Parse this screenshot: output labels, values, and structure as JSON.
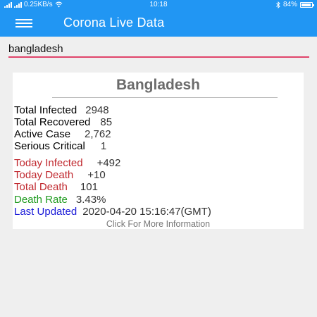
{
  "status_bar": {
    "network_speed": "0.25KB/s",
    "time": "10:18",
    "battery": "84%",
    "battery_level": 0.84,
    "icons": [
      "signal-icon",
      "wifi-icon",
      "bluetooth-icon",
      "battery-icon"
    ]
  },
  "app_bar": {
    "title": "Corona Live Data",
    "menu_icon": "hamburger-menu-icon"
  },
  "search": {
    "value": "bangladesh"
  },
  "card": {
    "country": "Bangladesh",
    "stats": [
      {
        "label": "Total Infected",
        "value": "2948",
        "color": "#111111"
      },
      {
        "label": "Total Recovered",
        "value": "85",
        "color": "#111111"
      },
      {
        "label": "Active Case",
        "value": "2,762",
        "color": "#111111"
      },
      {
        "label": "Serious Critical",
        "value": "1",
        "color": "#111111"
      },
      {
        "label": "Today Infected",
        "value": "+492",
        "color": "#c0282e"
      },
      {
        "label": "Today Death",
        "value": "+10",
        "color": "#c0282e"
      },
      {
        "label": "Total Death",
        "value": "101",
        "color": "#c0282e"
      },
      {
        "label": "Death Rate",
        "value": "3.43%",
        "color": "#1e9a1e"
      },
      {
        "label": "Last Updated",
        "value": "2020-04-20 15:16:47(GMT)",
        "color": "#1a1ad8"
      }
    ],
    "more_info": "Click For More Information"
  },
  "colors": {
    "primary": "#2196f3",
    "input_underline": "#e0446a",
    "background": "#efefef"
  }
}
